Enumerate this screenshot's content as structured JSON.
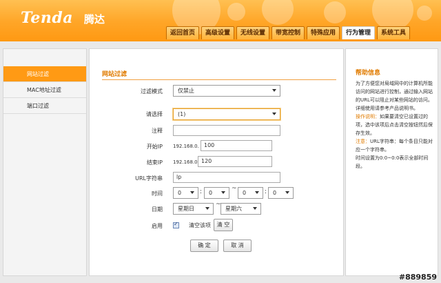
{
  "brand": {
    "logo": "Tenda",
    "logo_cn": "腾达"
  },
  "nav": {
    "tabs": [
      "返回首页",
      "高级设置",
      "无线设置",
      "带宽控制",
      "特殊应用",
      "行为管理",
      "系统工具"
    ],
    "active": "行为管理"
  },
  "sidebar": {
    "items": [
      {
        "label": "网站过滤",
        "active": true
      },
      {
        "label": "MAC地址过滤",
        "active": false
      },
      {
        "label": "端口过滤",
        "active": false
      }
    ]
  },
  "form": {
    "title": "网站过滤",
    "filter_mode": {
      "label": "过滤模式",
      "value": "仅禁止"
    },
    "select_rule": {
      "label": "请选择",
      "value": "(1)"
    },
    "remark": {
      "label": "注释",
      "value": ""
    },
    "start_ip": {
      "label": "开始IP",
      "prefix": "192.168.0.",
      "value": "100"
    },
    "end_ip": {
      "label": "结束IP",
      "prefix": "192.168.0.",
      "value": "120"
    },
    "url": {
      "label": "URL字符串",
      "value": "lp"
    },
    "time": {
      "label": "时间",
      "start_h": "0",
      "start_m": "0",
      "end_h": "0",
      "end_m": "0",
      "sep": ":",
      "range": "~"
    },
    "date": {
      "label": "日期",
      "from": "星期日",
      "to": "星期六",
      "range": "~"
    },
    "enable": {
      "label": "启用",
      "checked": true,
      "clear_label": "清空该项",
      "clear_button": "清 空"
    },
    "ok_button": "确 定",
    "cancel_button": "取 消"
  },
  "help": {
    "title": "帮助信息",
    "p1": "为了方便您对局域网中的计算机所能访问的网站进行控制，通过输入网站的URL可以阻止对某些网站的访问。详细使用请参考产品说明书。",
    "p2_label": "操作说明：",
    "p2": "如果要清空已设置过的项，选中该项后点击清空按钮然后保存生效。",
    "p3_label": "注意：",
    "p3": "URL字符串：每个条目只能对应一个字符串。",
    "p4": "时间设置为0:0~0:0表示全部时间段。"
  },
  "watermark": "#889859",
  "colors": {
    "accent": "#ff9a14",
    "title_orange": "#e07b00"
  }
}
